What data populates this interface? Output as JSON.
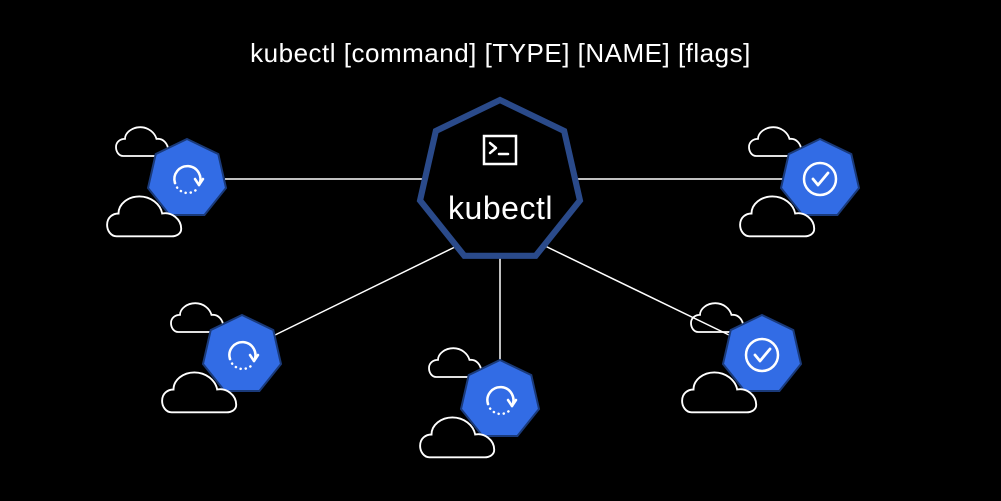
{
  "title": "kubectl [command] [TYPE] [NAME] [flags]",
  "center": {
    "label": "kubectl",
    "icon": "terminal-icon"
  },
  "nodes": [
    {
      "id": "top-left",
      "icon": "refresh-icon",
      "status": "loading"
    },
    {
      "id": "top-right",
      "icon": "checkmark-icon",
      "status": "ready"
    },
    {
      "id": "bottom-left",
      "icon": "refresh-icon",
      "status": "loading"
    },
    {
      "id": "bottom-center",
      "icon": "refresh-icon",
      "status": "loading"
    },
    {
      "id": "bottom-right",
      "icon": "checkmark-icon",
      "status": "ready"
    }
  ],
  "colors": {
    "background": "#000000",
    "foreground": "#ffffff",
    "accent": "#326ce5",
    "hexStroke": "#1a3a7a"
  }
}
